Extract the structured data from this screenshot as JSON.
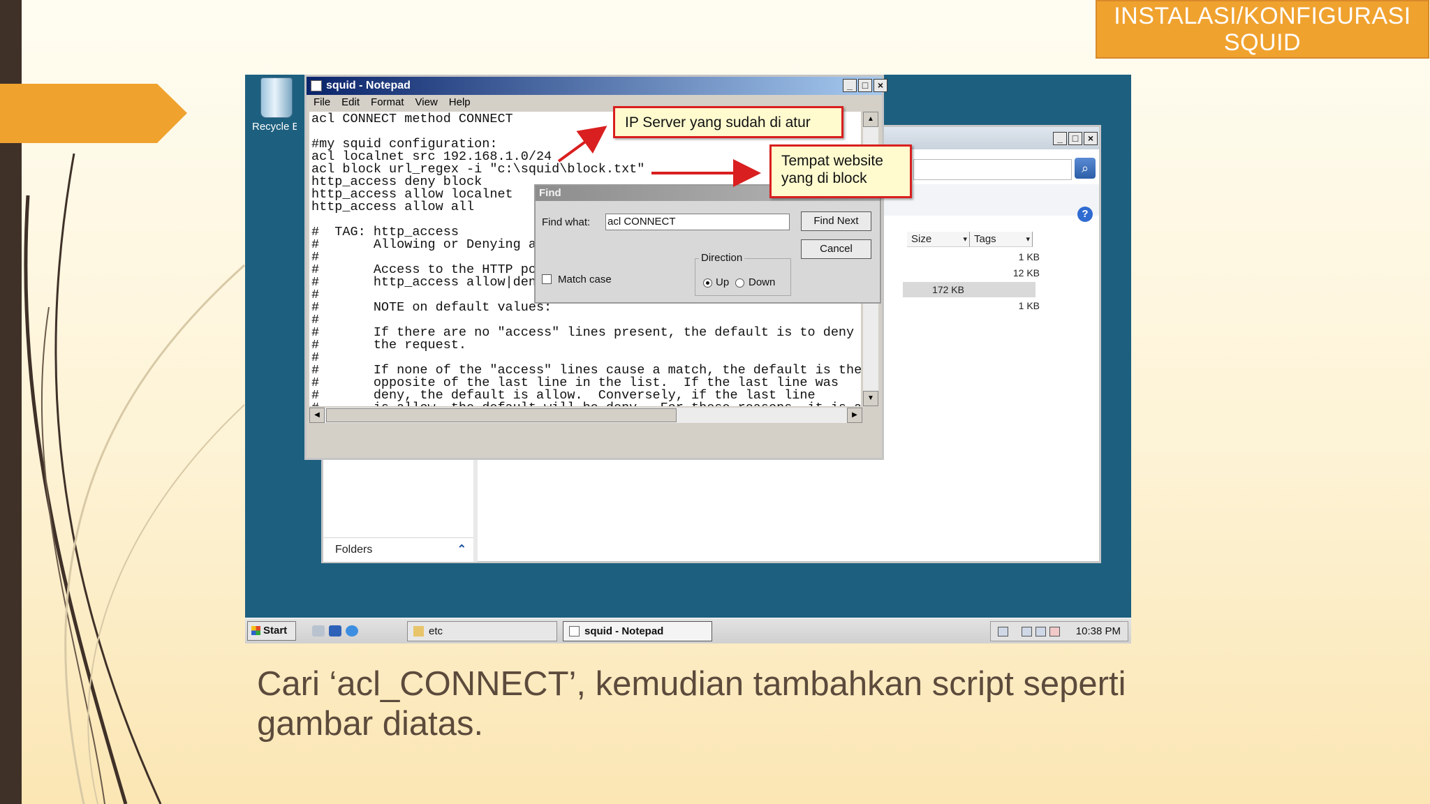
{
  "slide": {
    "title": "INSTALASI/KONFIGURASI SQUID",
    "caption": "Cari ‘acl_CONNECT’, kemudian tambahkan script seperti gambar diatas.",
    "accent_color": "#f0a22f",
    "sidebar_color": "#3f3128",
    "caption_color": "#5c4a3c"
  },
  "desktop": {
    "recycle_bin_label": "Recycle Bin",
    "background_color": "#1d5f7f"
  },
  "explorer": {
    "columns": [
      {
        "label": "Size"
      },
      {
        "label": "Tags"
      }
    ],
    "sizes": [
      "1 KB",
      "12 KB",
      "172 KB",
      "1 KB"
    ],
    "selected_row_index": 2,
    "folders_label": "Folders"
  },
  "notepad": {
    "title": "squid - Notepad",
    "menu": [
      "File",
      "Edit",
      "Format",
      "View",
      "Help"
    ],
    "text": "acl CONNECT method CONNECT\n\n#my squid configuration:\nacl localnet src 192.168.1.0/24\nacl block url_regex -i \"c:\\squid\\block.txt\"\nhttp_access deny block\nhttp_access allow localnet\nhttp_access allow all\n\n#  TAG: http_access\n#       Allowing or Denying access based on defined access lists\n#\n#       Access to the HTTP port:\n#       http_access allow|deny [!]aclname ...\n#\n#       NOTE on default values:\n#\n#       If there are no \"access\" lines present, the default is to deny\n#       the request.\n#\n#       If none of the \"access\" lines cause a match, the default is the\n#       opposite of the last line in the list.  If the last line was\n#       deny, the default is allow.  Conversely, if the last line\n#       is allow, the default will be deny.  For these reasons, it is a\n#       good idea to have an \"deny all\" or \"allow all\" entry at the end"
  },
  "find_dialog": {
    "title": "Find",
    "find_what_label": "Find what:",
    "find_what_value": "acl CONNECT",
    "find_next": "Find Next",
    "cancel": "Cancel",
    "direction_label": "Direction",
    "up": "Up",
    "down": "Down",
    "match_case": "Match case",
    "direction_selected": "up"
  },
  "callouts": {
    "ip_server": "IP Server yang sudah di atur",
    "blocked_sites_line1": "Tempat website",
    "blocked_sites_line2": "yang di block",
    "border_color": "#d91f1f",
    "fill_color": "#fffbcf"
  },
  "taskbar": {
    "start": "Start",
    "tasks": [
      "etc",
      "squid - Notepad"
    ],
    "active_task_index": 1,
    "clock": "10:38 PM"
  }
}
